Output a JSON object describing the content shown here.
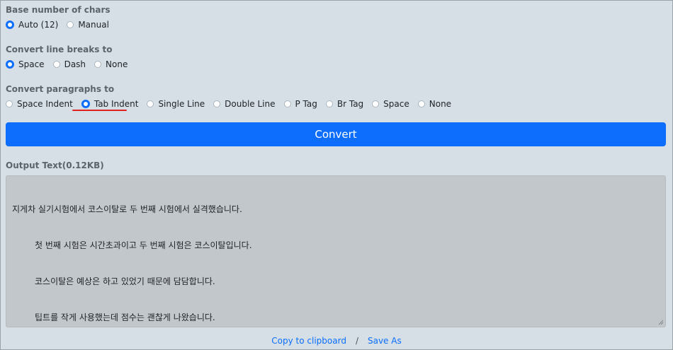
{
  "base_chars": {
    "label": "Base number of chars",
    "options": [
      {
        "label": "Auto (12)",
        "checked": true
      },
      {
        "label": "Manual",
        "checked": false
      }
    ]
  },
  "line_breaks": {
    "label": "Convert line breaks to",
    "options": [
      {
        "label": "Space",
        "checked": true
      },
      {
        "label": "Dash",
        "checked": false
      },
      {
        "label": "None",
        "checked": false
      }
    ]
  },
  "paragraphs": {
    "label": "Convert paragraphs to",
    "options": [
      {
        "label": "Space Indent",
        "checked": false
      },
      {
        "label": "Tab Indent",
        "checked": true
      },
      {
        "label": "Single Line",
        "checked": false
      },
      {
        "label": "Double Line",
        "checked": false
      },
      {
        "label": "P Tag",
        "checked": false
      },
      {
        "label": "Br Tag",
        "checked": false
      },
      {
        "label": "Space",
        "checked": false
      },
      {
        "label": "None",
        "checked": false
      }
    ]
  },
  "convert_button": "Convert",
  "output": {
    "label": "Output Text",
    "size": "(0.12KB)",
    "lines": [
      "지게차 실기시험에서 코스이탈로 두 번째 시험에서 실격했습니다.",
      "첫 번째 시험은 시간초과이고 두 번째 시험은 코스이탈입니다.",
      "코스이탈은 예상은 하고 있었기 때문에 담담합니다.",
      "팁트를 작게 사용했는데 점수는 괜찮게 나왔습니다."
    ]
  },
  "footer": {
    "copy": "Copy to clipboard",
    "separator": "/",
    "save": "Save As"
  },
  "colors": {
    "accent": "#0d6efd",
    "highlight_underline": "#e0201c",
    "background": "#d5dfe5"
  }
}
